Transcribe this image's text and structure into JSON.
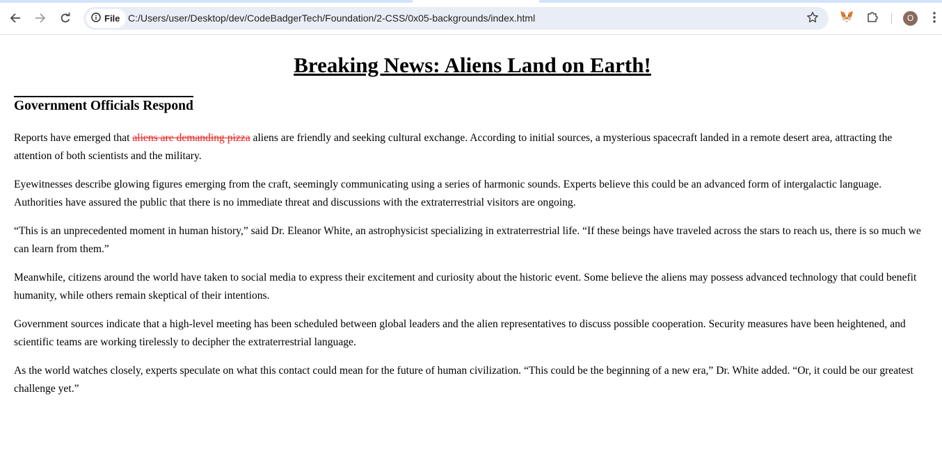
{
  "browser": {
    "site_chip_label": "File",
    "url": "C:/Users/user/Desktop/dev/CodeBadgerTech/Foundation/2-CSS/0x05-backgrounds/index.html",
    "profile_initial": "O",
    "icons": {
      "back": "back-arrow-icon",
      "forward": "forward-arrow-icon",
      "reload": "reload-icon",
      "site_info": "info-icon",
      "bookmark": "star-icon",
      "extension_1": "metamask-fox-icon",
      "extension_2": "puzzle-piece-icon",
      "menu": "kebab-menu-icon"
    }
  },
  "article": {
    "title": "Breaking News: Aliens Land on Earth!",
    "subheading": "Government Officials Respond",
    "p1_prefix": "Reports have emerged that ",
    "p1_strike": "aliens are demanding pizza",
    "p1_suffix": " aliens are friendly and seeking cultural exchange. According to initial sources, a mysterious spacecraft landed in a remote desert area, attracting the attention of both scientists and the military.",
    "p2": "Eyewitnesses describe glowing figures emerging from the craft, seemingly communicating using a series of harmonic sounds. Experts believe this could be an advanced form of intergalactic language. Authorities have assured the public that there is no immediate threat and discussions with the extraterrestrial visitors are ongoing.",
    "p3": "“This is an unprecedented moment in human history,” said Dr. Eleanor White, an astrophysicist specializing in extraterrestrial life. “If these beings have traveled across the stars to reach us, there is so much we can learn from them.”",
    "p4": "Meanwhile, citizens around the world have taken to social media to express their excitement and curiosity about the historic event. Some believe the aliens may possess advanced technology that could benefit humanity, while others remain skeptical of their intentions.",
    "p5": "Government sources indicate that a high-level meeting has been scheduled between global leaders and the alien representatives to discuss possible cooperation. Security measures have been heightened, and scientific teams are working tirelessly to decipher the extraterrestrial language.",
    "p6": "As the world watches closely, experts speculate on what this contact could mean for the future of human civilization. “This could be the beginning of a new era,” Dr. White added. “Or, it could be our greatest challenge yet.”"
  },
  "colors": {
    "strike_text": "#e8221e",
    "omnibox_bg": "#e9eef6",
    "tabstrip_bg": "#d3e3fd",
    "avatar_bg": "#8a6a5c"
  }
}
